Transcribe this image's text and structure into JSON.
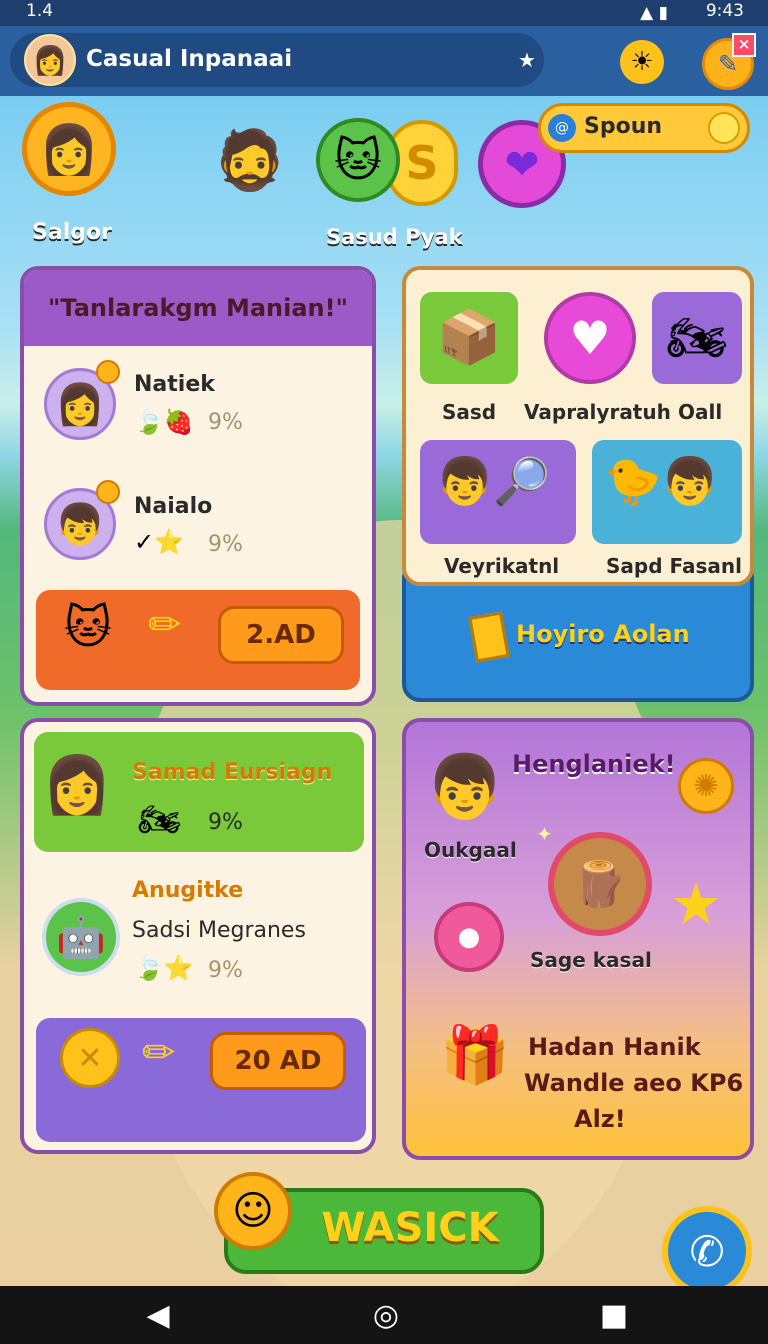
{
  "status_bar": {
    "left_text": "1.4",
    "time": "9:43"
  },
  "header": {
    "title": "Casual Inpanaai"
  },
  "top_row": {
    "player_name": "Salgor",
    "center_label": "Sasud Pyak",
    "resource_label": "Spoun"
  },
  "mission_panel": {
    "title": "\"Tanlarakgm Manian!\"",
    "rows": [
      {
        "name": "Natiek",
        "reward": "9%"
      },
      {
        "name": "Naialo",
        "reward": "9%"
      }
    ],
    "claim_label": "2.AD"
  },
  "shop_panel": {
    "items": [
      {
        "label": "Sasd"
      },
      {
        "label": "Vapralyratuh"
      },
      {
        "label": "Oall"
      },
      {
        "label": "Veyrikatnl"
      },
      {
        "label": "Sapd Fasanl"
      }
    ],
    "action_label": "Hoyiro Aolan"
  },
  "event_panel": {
    "featured_title": "Samad Eursiagn",
    "featured_reward": "9%",
    "second_title": "Anugitke",
    "second_subtitle": "Sadsi Megranes",
    "second_reward": "9%",
    "claim_label": "20 AD"
  },
  "promo_panel": {
    "title": "Henglaniek!",
    "character_label": "Oukgaal",
    "item_label": "Sage kasal",
    "headline_line1": "Hadan Hanik",
    "headline_line2": "Wandle aeo KP6",
    "headline_line3": "Alz!"
  },
  "play_button": {
    "label": "WASICK"
  },
  "colors": {
    "header_bg": "#2a5fa0",
    "accent_orange": "#ff9a1a",
    "panel_purple": "#8a4ea8",
    "play_green": "#4cb83a",
    "gold_text": "#ffd21a"
  },
  "icons": {
    "title_avatar": "avatar-icon",
    "sun_button": "sun-icon",
    "pin_button": "pin-icon",
    "close": "close-icon",
    "phone": "phone-icon"
  }
}
